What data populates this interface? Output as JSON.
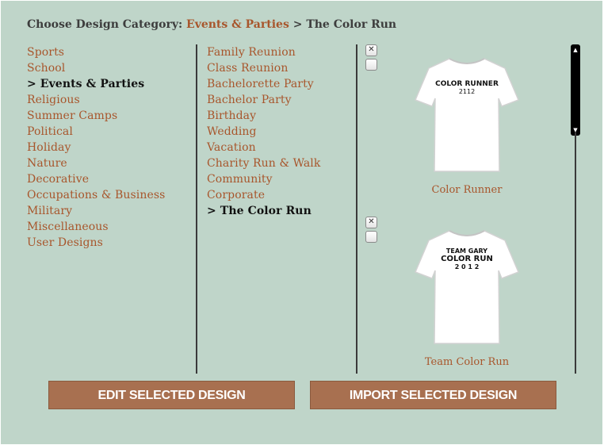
{
  "header": {
    "prefix": "Choose Design Category:",
    "current": "Events & Parties",
    "separator": ">",
    "subcategory": "The Color Run"
  },
  "categories": [
    {
      "label": "Sports"
    },
    {
      "label": "School"
    },
    {
      "label": "> Events & Parties",
      "selected": true
    },
    {
      "label": "Religious"
    },
    {
      "label": "Summer Camps"
    },
    {
      "label": "Political"
    },
    {
      "label": "Holiday"
    },
    {
      "label": "Nature"
    },
    {
      "label": "Decorative"
    },
    {
      "label": "Occupations & Business"
    },
    {
      "label": "Military"
    },
    {
      "label": "Miscellaneous"
    },
    {
      "label": "User Designs"
    }
  ],
  "subcategories": [
    {
      "label": "Family Reunion"
    },
    {
      "label": "Class Reunion"
    },
    {
      "label": "Bachelorette Party"
    },
    {
      "label": "Bachelor Party"
    },
    {
      "label": "Birthday"
    },
    {
      "label": "Wedding"
    },
    {
      "label": "Vacation"
    },
    {
      "label": "Charity Run & Walk"
    },
    {
      "label": "Community"
    },
    {
      "label": "Corporate"
    },
    {
      "label": "> The Color Run",
      "selected": true
    }
  ],
  "designs": [
    {
      "name": "Color Runner",
      "shirt_lines": [
        "COLOR RUNNER",
        "2112"
      ],
      "remove_icon": "close-icon",
      "checked": false
    },
    {
      "name": "Team Color Run",
      "shirt_lines": [
        "TEAM GARY",
        "COLOR RUN",
        "2 0 1 2"
      ],
      "remove_icon": "close-icon",
      "checked": false
    }
  ],
  "buttons": {
    "edit": "EDIT SELECTED DESIGN",
    "import": "IMPORT SELECTED DESIGN"
  },
  "colors": {
    "background": "#bfd5c9",
    "link": "#a8562c",
    "button": "#a87050"
  },
  "scrollbar": {
    "up_icon": "▲",
    "down_icon": "▼"
  }
}
